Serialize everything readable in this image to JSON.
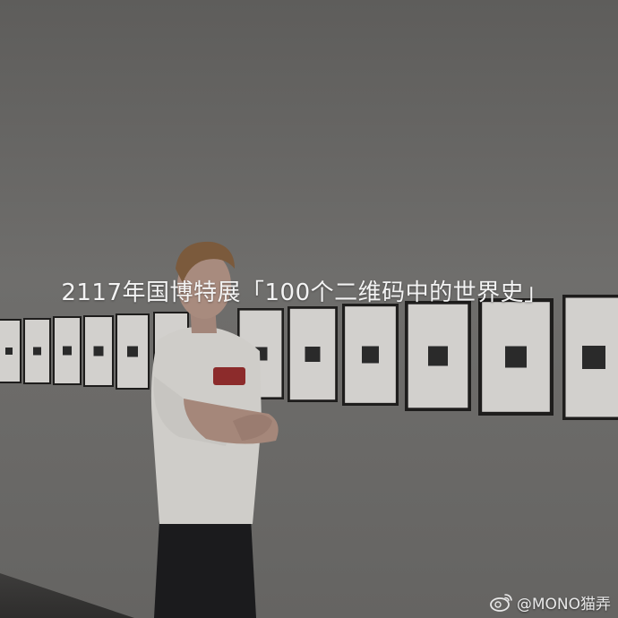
{
  "caption": "2117年国博特展「100个二维码中的世界史」",
  "watermark": {
    "icon": "weibo-icon",
    "handle": "@MONO猫弄"
  },
  "colors": {
    "wall": "#6f6e6c",
    "frame": "#1e1d1c",
    "mat": "#d2d0cd",
    "caption_text": "#f3f3f3"
  }
}
